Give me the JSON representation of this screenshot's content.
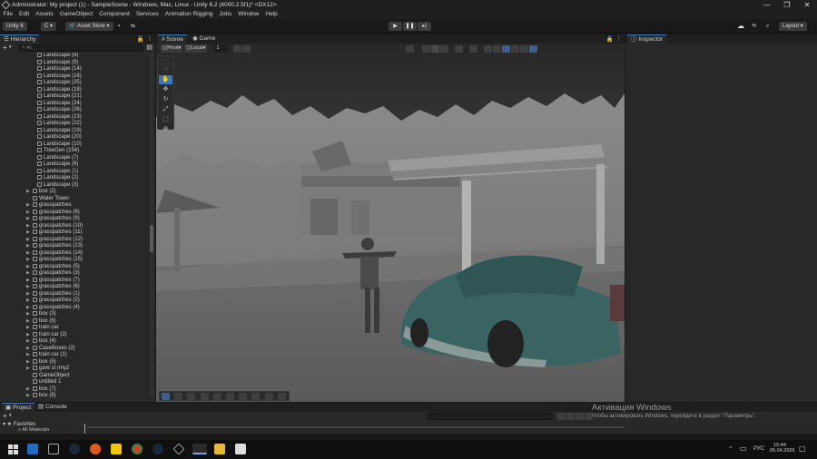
{
  "window": {
    "title": "Administrator: My project (1) - SampleScene - Windows, Mac, Linux - Unity 6.2 (6000.2.5f1)* <DX12>",
    "minimize": "—",
    "maximize": "❐",
    "close": "✕"
  },
  "menu": [
    "File",
    "Edit",
    "Assets",
    "GameObject",
    "Component",
    "Services",
    "Animation Rigging",
    "Jobs",
    "Window",
    "Help"
  ],
  "toolbar": {
    "account": "Unity 6",
    "cloud_label": "C",
    "asset_store": "Asset Store",
    "layout": "Layout"
  },
  "hierarchy": {
    "tab": "Hierarchy",
    "search_placeholder": "All",
    "items": [
      {
        "label": "Landscape (8)",
        "indent": 2,
        "arrow": false
      },
      {
        "label": "Landscape (9)",
        "indent": 2,
        "arrow": false
      },
      {
        "label": "Landscape (14)",
        "indent": 2,
        "arrow": false
      },
      {
        "label": "Landscape (16)",
        "indent": 2,
        "arrow": false
      },
      {
        "label": "Landscape (25)",
        "indent": 2,
        "arrow": false
      },
      {
        "label": "Landscape (18)",
        "indent": 2,
        "arrow": false
      },
      {
        "label": "Landscape (21)",
        "indent": 2,
        "arrow": false
      },
      {
        "label": "Landscape (24)",
        "indent": 2,
        "arrow": false
      },
      {
        "label": "Landscape (26)",
        "indent": 2,
        "arrow": false
      },
      {
        "label": "Landscape (23)",
        "indent": 2,
        "arrow": false
      },
      {
        "label": "Landscape (22)",
        "indent": 2,
        "arrow": false
      },
      {
        "label": "Landscape (19)",
        "indent": 2,
        "arrow": false
      },
      {
        "label": "Landscape (20)",
        "indent": 2,
        "arrow": false
      },
      {
        "label": "Landscape (10)",
        "indent": 2,
        "arrow": false
      },
      {
        "label": "TreeGen (154)",
        "indent": 2,
        "arrow": false
      },
      {
        "label": "Landscape (7)",
        "indent": 2,
        "arrow": false
      },
      {
        "label": "Landscape (6)",
        "indent": 2,
        "arrow": false
      },
      {
        "label": "Landscape (1)",
        "indent": 2,
        "arrow": false
      },
      {
        "label": "Landscape (2)",
        "indent": 2,
        "arrow": false
      },
      {
        "label": "Landscape (3)",
        "indent": 2,
        "arrow": false
      },
      {
        "label": "box (2)",
        "indent": 1,
        "arrow": true
      },
      {
        "label": "Water Tower",
        "indent": 1,
        "arrow": false
      },
      {
        "label": "grasspatches",
        "indent": 1,
        "arrow": true
      },
      {
        "label": "grasspatches (8)",
        "indent": 1,
        "arrow": true
      },
      {
        "label": "grasspatches (9)",
        "indent": 1,
        "arrow": true
      },
      {
        "label": "grasspatches (10)",
        "indent": 1,
        "arrow": true
      },
      {
        "label": "grasspatches (11)",
        "indent": 1,
        "arrow": true
      },
      {
        "label": "grasspatches (12)",
        "indent": 1,
        "arrow": true
      },
      {
        "label": "grasspatches (13)",
        "indent": 1,
        "arrow": true
      },
      {
        "label": "grasspatches (14)",
        "indent": 1,
        "arrow": true
      },
      {
        "label": "grasspatches (15)",
        "indent": 1,
        "arrow": true
      },
      {
        "label": "grasspatches (5)",
        "indent": 1,
        "arrow": true
      },
      {
        "label": "grasspatches (3)",
        "indent": 1,
        "arrow": true
      },
      {
        "label": "grasspatches (7)",
        "indent": 1,
        "arrow": true
      },
      {
        "label": "grasspatches (6)",
        "indent": 1,
        "arrow": true
      },
      {
        "label": "grasspatches (1)",
        "indent": 1,
        "arrow": true
      },
      {
        "label": "grasspatches (2)",
        "indent": 1,
        "arrow": true
      },
      {
        "label": "grasspatches (4)",
        "indent": 1,
        "arrow": true
      },
      {
        "label": "box (3)",
        "indent": 1,
        "arrow": true
      },
      {
        "label": "box (6)",
        "indent": 1,
        "arrow": true
      },
      {
        "label": "train car",
        "indent": 1,
        "arrow": true
      },
      {
        "label": "train car (2)",
        "indent": 1,
        "arrow": true
      },
      {
        "label": "box (4)",
        "indent": 1,
        "arrow": true
      },
      {
        "label": "CaseBoxes (2)",
        "indent": 1,
        "arrow": true
      },
      {
        "label": "train car (1)",
        "indent": 1,
        "arrow": true
      },
      {
        "label": "box (5)",
        "indent": 1,
        "arrow": true
      },
      {
        "label": "gare st rmy2",
        "indent": 1,
        "arrow": true
      },
      {
        "label": "GameObject",
        "indent": 1,
        "arrow": false
      },
      {
        "label": "untitled 1",
        "indent": 1,
        "arrow": false
      },
      {
        "label": "box (7)",
        "indent": 1,
        "arrow": true
      },
      {
        "label": "box (8)",
        "indent": 1,
        "arrow": true
      }
    ]
  },
  "scene": {
    "tabs": [
      "Scene",
      "Game"
    ],
    "pivot": "Pivot",
    "local": "Local",
    "grid_value": "1"
  },
  "inspector": {
    "tab": "Inspector"
  },
  "project": {
    "tabs": [
      "Project",
      "Console"
    ],
    "favorites": "Favorites",
    "all_materials": "All Materials"
  },
  "watermark": {
    "line1": "Активация Windows",
    "line2": "Чтобы активировать Windows, перейдите в раздел \"Параметры\"."
  },
  "taskbar": {
    "lang": "РУС",
    "time": "15:44",
    "date": "05.04.2026"
  },
  "colors": {
    "accent": "#3a79bb",
    "panel": "#282828",
    "header": "#1f1f1f"
  }
}
